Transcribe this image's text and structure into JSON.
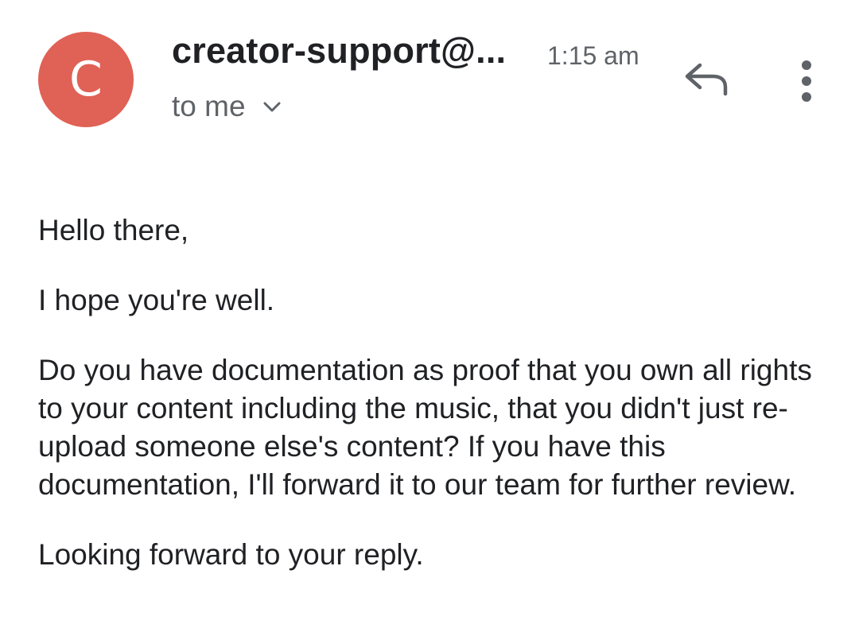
{
  "sender": {
    "avatar_letter": "C",
    "avatar_color": "#e06155",
    "address": "creator-support@...",
    "time": "1:15 am",
    "recipient": "to me",
    "recipient_icon": "chevron-down-icon"
  },
  "actions": {
    "reply_icon": "reply-icon",
    "more_icon": "more-vert-icon"
  },
  "message": {
    "greeting": "Hello there,",
    "line1": "I hope you're well.",
    "paragraph": "Do you have documentation as proof that you own all rights to your content including the music, that you didn't just re-upload someone else's content? If you have this documentation, I'll forward it to our team for further review.",
    "closing": "Looking forward to your reply."
  }
}
